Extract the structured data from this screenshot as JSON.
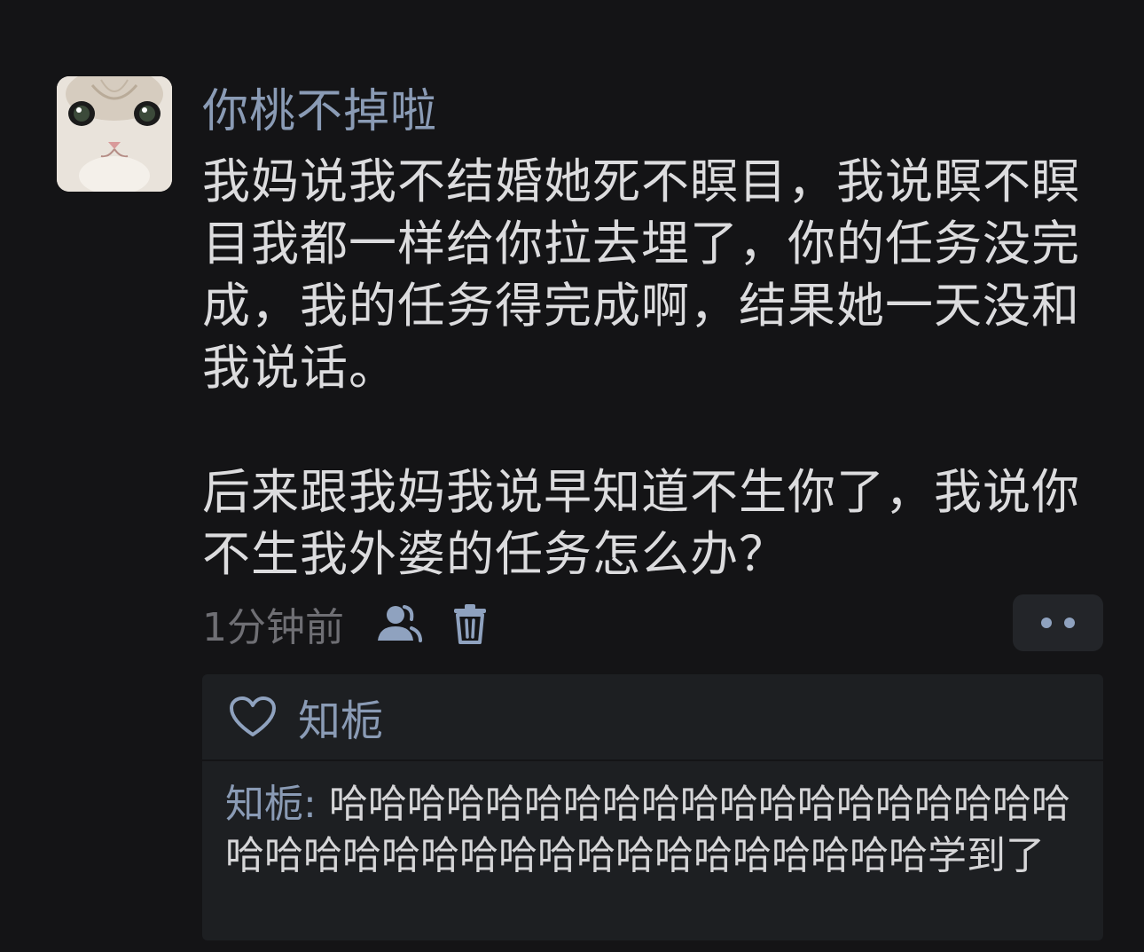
{
  "post": {
    "avatar_icon": "cat-avatar",
    "username": "你桃不掉啦",
    "paragraphs": [
      "我妈说我不结婚她死不瞑目，我说瞑不瞑目我都一样给你拉去埋了，你的任务没完成，我的任务得完成啊，结果她一天没和我说话。",
      "后来跟我妈我说早知道不生你了，我说你不生我外婆的任务怎么办？"
    ],
    "timestamp": "1分钟前",
    "icons": {
      "visibility": "user-group-icon",
      "delete": "trash-icon",
      "more": "more-dots-icon"
    }
  },
  "likes": {
    "icon": "heart-icon",
    "names": "知栀"
  },
  "replies": [
    {
      "author": "知栀",
      "separator": ":",
      "text": "哈哈哈哈哈哈哈哈哈哈哈哈哈哈哈哈哈哈哈哈哈哈哈哈哈哈哈哈哈哈哈哈哈哈哈哈哈学到了"
    }
  ],
  "colors": {
    "background": "#141416",
    "name_accent": "#8a9bb5",
    "text": "#dcdcde",
    "muted": "#6f6f74",
    "panel": "#1d1f22"
  }
}
